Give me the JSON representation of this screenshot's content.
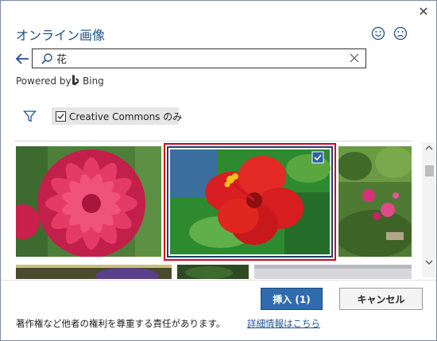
{
  "dialog": {
    "title": "オンライン画像",
    "close_icon": "close-icon"
  },
  "feedback": {
    "smile_icon": "smile-icon",
    "frown_icon": "frown-icon"
  },
  "search": {
    "value": "花",
    "placeholder": ""
  },
  "powered": {
    "prefix": "Powered by",
    "brand": "Bing"
  },
  "filters": {
    "creative_commons_label": "Creative Commons のみ",
    "creative_commons_checked": true
  },
  "results": {
    "images": [
      {
        "subject": "pink dahlia"
      },
      {
        "subject": "red hibiscus",
        "selected": true
      },
      {
        "subject": "peonies in garden"
      },
      {
        "subject": "thumbnail"
      },
      {
        "subject": "thumbnail"
      },
      {
        "subject": "thumbnail"
      }
    ]
  },
  "buttons": {
    "insert_label": "挿入 (1)",
    "cancel_label": "キャンセル"
  },
  "footer": {
    "notice": "著作権など他者の権利を尊重する責任があります。",
    "more_info": "詳細情報はこちら"
  },
  "colors": {
    "accent": "#2f6cad",
    "selection": "#d0021b"
  }
}
